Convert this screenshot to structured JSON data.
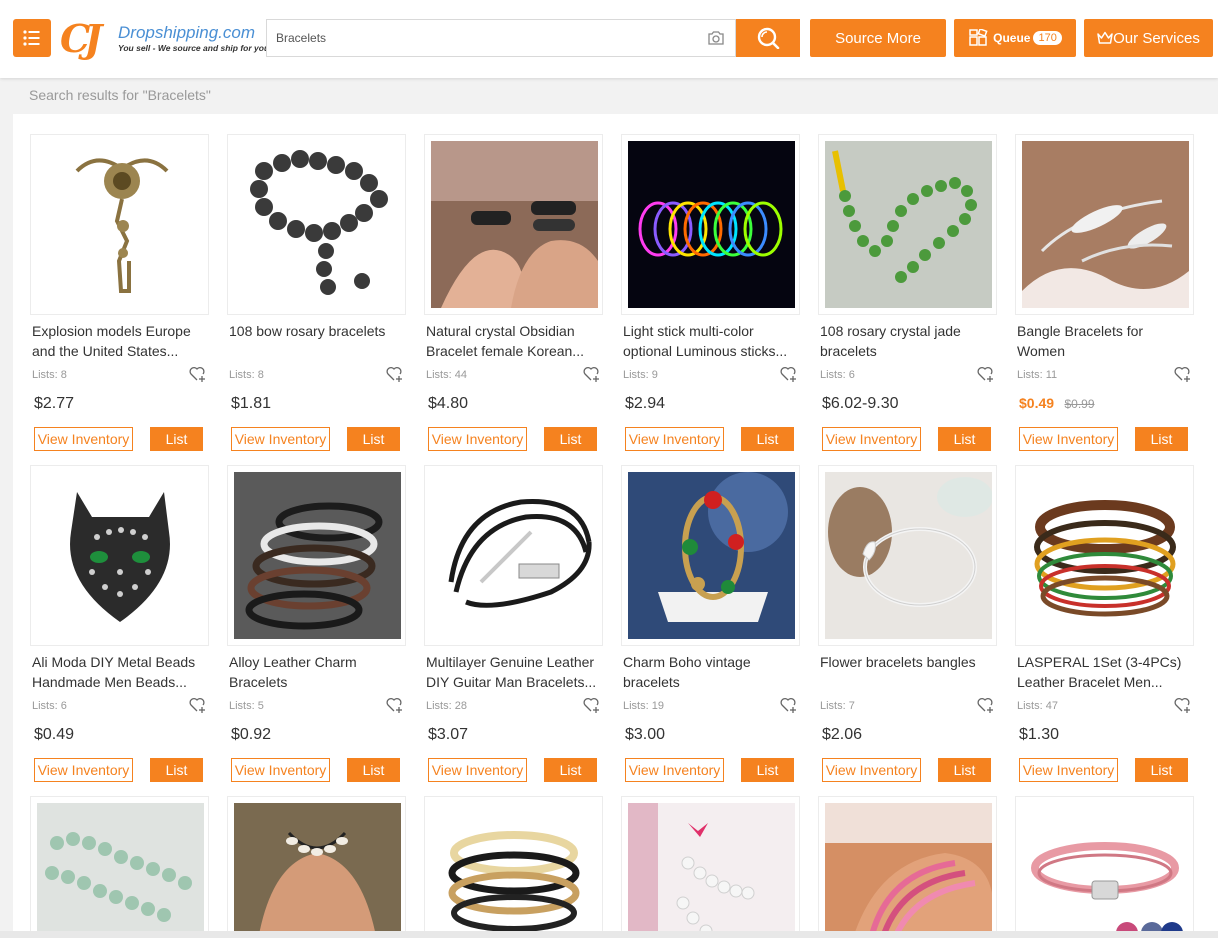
{
  "header": {
    "logo_mark": "CJ",
    "logo_name": "Dropshipping.com",
    "logo_slogan": "You sell - We source and ship for you!",
    "search_value": "Bracelets",
    "source_more": "Source More",
    "queue_label": "Queue",
    "queue_count": "170",
    "our_services": "Our Services"
  },
  "results": {
    "summary": "Search results for \"Bracelets\"",
    "products": [
      {
        "title": "Explosion models Europe and the United States...",
        "lists": "Lists: 8",
        "price": "$2.77"
      },
      {
        "title": "108 bow rosary bracelets",
        "lists": "Lists: 8",
        "price": "$1.81"
      },
      {
        "title": "Natural crystal Obsidian Bracelet female Korean...",
        "lists": "Lists: 44",
        "price": "$4.80"
      },
      {
        "title": "Light stick multi-color optional Luminous sticks...",
        "lists": "Lists: 9",
        "price": "$2.94"
      },
      {
        "title": "108 rosary crystal jade bracelets",
        "lists": "Lists: 6",
        "price": "$6.02-9.30"
      },
      {
        "title": "Bangle Bracelets for Women",
        "lists": "Lists: 11",
        "price": "$0.49",
        "old_price": "$0.99"
      },
      {
        "title": "Ali Moda DIY Metal Beads Handmade Men Beads...",
        "lists": "Lists: 6",
        "price": "$0.49"
      },
      {
        "title": "Alloy Leather Charm Bracelets",
        "lists": "Lists: 5",
        "price": "$0.92"
      },
      {
        "title": "Multilayer Genuine Leather DIY Guitar Man Bracelets...",
        "lists": "Lists: 28",
        "price": "$3.07"
      },
      {
        "title": "Charm Boho vintage bracelets",
        "lists": "Lists: 19",
        "price": "$3.00"
      },
      {
        "title": "Flower bracelets bangles",
        "lists": "Lists: 7",
        "price": "$2.06"
      },
      {
        "title": "LASPERAL 1Set (3-4PCs) Leather Bracelet Men...",
        "lists": "Lists: 47",
        "price": "$1.30"
      }
    ],
    "view_inventory_label": "View Inventory",
    "list_label": "List"
  },
  "colors": {
    "accent": "#f5821f",
    "logo_blue": "#4a8fd4"
  },
  "icons": [
    "menu-icon",
    "camera-icon",
    "search-icon",
    "queue-icon",
    "crown-icon",
    "heart-plus-icon"
  ]
}
